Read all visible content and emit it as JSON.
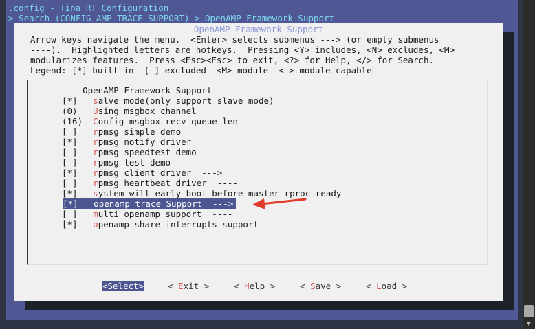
{
  "header": {
    "title": ".config - Tina RT Configuration",
    "breadcrumb": "> Search (CONFIG_AMP_TRACE_SUPPORT) > OpenAMP Framework Support"
  },
  "dialog": {
    "title": "OpenAMP Framework Support",
    "help": [
      "Arrow keys navigate the menu.  <Enter> selects submenus ---> (or empty submenus",
      "----).  Highlighted letters are hotkeys.  Pressing <Y> includes, <N> excludes, <M>",
      "modularizes features.  Press <Esc><Esc> to exit, <?> for Help, </> for Search.",
      "Legend: [*] built-in  [ ] excluded  <M> module  < > module capable"
    ]
  },
  "menu": [
    {
      "prefix": "--- ",
      "hotkey": "",
      "label": "OpenAMP Framework Support"
    },
    {
      "prefix": "[*]   ",
      "hotkey": "s",
      "label": "alve mode(only support slave mode)"
    },
    {
      "prefix": "(0)   ",
      "hotkey": "U",
      "label": "sing msgbox channel"
    },
    {
      "prefix": "(16)  ",
      "hotkey": "C",
      "label": "onfig msgbox recv queue len"
    },
    {
      "prefix": "[ ]   ",
      "hotkey": "r",
      "label": "pmsg simple demo"
    },
    {
      "prefix": "[*]   ",
      "hotkey": "r",
      "label": "pmsg notify driver"
    },
    {
      "prefix": "[ ]   ",
      "hotkey": "r",
      "label": "pmsg speedtest demo"
    },
    {
      "prefix": "[ ]   ",
      "hotkey": "r",
      "label": "pmsg test demo"
    },
    {
      "prefix": "[*]   ",
      "hotkey": "r",
      "label": "pmsg client driver  --->"
    },
    {
      "prefix": "[ ]   ",
      "hotkey": "r",
      "label": "pmsg heartbeat driver  ----"
    },
    {
      "prefix": "[*]   ",
      "hotkey": "s",
      "label": "ystem will early boot before master rproc ready"
    },
    {
      "prefix": "[*]   ",
      "hotkey": "o",
      "label": "penamp trace Support  --->",
      "selected": true
    },
    {
      "prefix": "[ ]   ",
      "hotkey": "m",
      "label": "ulti openamp support  ----"
    },
    {
      "prefix": "[*]   ",
      "hotkey": "o",
      "label": "penamp share interrupts support"
    }
  ],
  "buttons": {
    "select": "<Select>",
    "exit": {
      "pre": "< ",
      "hotkey": "E",
      "post": "xit >"
    },
    "help": {
      "pre": "< ",
      "hotkey": "H",
      "post": "elp >"
    },
    "save": {
      "pre": "< ",
      "hotkey": "S",
      "post": "ave >"
    },
    "load": {
      "pre": "< ",
      "hotkey": "L",
      "post": "oad >"
    }
  },
  "colors": {
    "header_text": "#7fd8f0",
    "screen_bg": "#4f5894",
    "selection_bg": "#4c5690",
    "hotkey": "#d65a5a",
    "annotation_arrow": "#e23b2e"
  }
}
